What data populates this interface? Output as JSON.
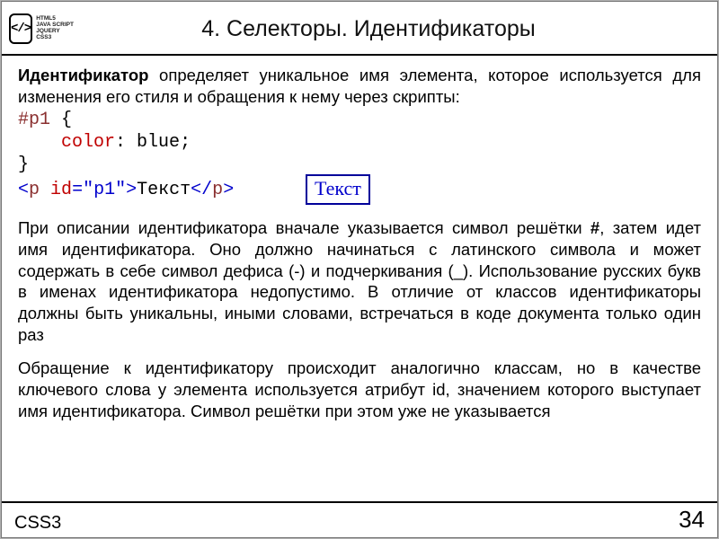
{
  "header": {
    "logo_symbol": "</>",
    "logo_lines": "HTML5\nJAVA SCRIPT\nJQUERY\nCSS3",
    "title": "4. Селекторы. Идентификаторы"
  },
  "content": {
    "intro_bold": "Идентификатор",
    "intro_rest": " определяет уникальное имя элемента, которое используется для изменения его стиля и обращения к нему через скрипты:",
    "code": {
      "l1_a": "#p1 ",
      "l1_b": "{",
      "l2_indent": "    ",
      "l2_prop": "color",
      "l2_colon": ": ",
      "l2_val": "blue",
      "l2_semi": ";",
      "l3": "}"
    },
    "html_line": {
      "lt1": "<",
      "tag1": "p",
      "sp": " ",
      "attr": "id",
      "eq": "=",
      "q1": "\"",
      "val": "p1",
      "q2": "\"",
      "gt1": ">",
      "text": "Текст",
      "lt2": "</",
      "tag2": "p",
      "gt2": ">"
    },
    "demo_text": "Текст",
    "para2_a": "При описании идентификатора вначале указывается символ решётки ",
    "para2_hash": "#",
    "para2_b": ", затем идет имя идентификатора. Оно должно начинаться с латинского символа и может содержать в себе символ дефиса (-) и подчеркивания (_). Использование русских букв в именах идентификатора недопустимо. В отличие от классов идентификаторы должны быть уникальны, иными словами, встречаться в коде документа только один раз",
    "para3": "Обращение к идентификатору происходит аналогично классам, но в качестве ключевого слова у элемента используется атрибут id, значением которого выступает имя идентификатора. Символ решётки при этом уже не указывается"
  },
  "footer": {
    "left": "CSS3",
    "page": "34"
  }
}
